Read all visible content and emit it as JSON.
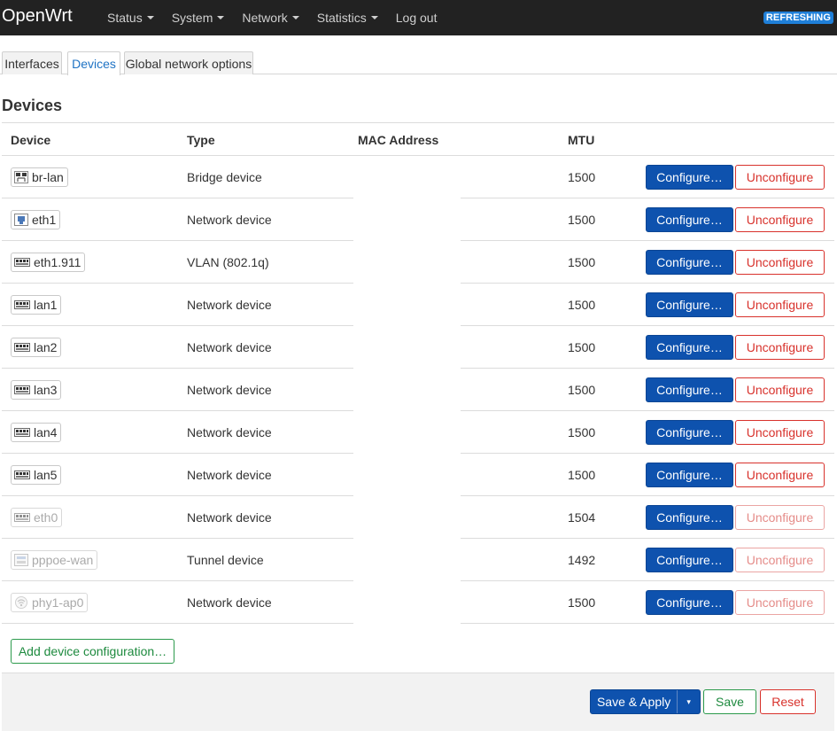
{
  "header": {
    "brand": "OpenWrt",
    "menu": [
      {
        "label": "Status",
        "dropdown": true
      },
      {
        "label": "System",
        "dropdown": true
      },
      {
        "label": "Network",
        "dropdown": true
      },
      {
        "label": "Statistics",
        "dropdown": true
      },
      {
        "label": "Log out",
        "dropdown": false
      }
    ],
    "badge": "REFRESHING"
  },
  "tabs": [
    {
      "label": "Interfaces",
      "active": false
    },
    {
      "label": "Devices",
      "active": true
    },
    {
      "label": "Global network options",
      "active": false
    }
  ],
  "section_title": "Devices",
  "table": {
    "columns": [
      "Device",
      "Type",
      "MAC Address",
      "MTU"
    ],
    "rows": [
      {
        "device": "br-lan",
        "icon": "bridge-icon",
        "type": "Bridge device",
        "mac": "",
        "mtu": "1500",
        "active": true
      },
      {
        "device": "eth1",
        "icon": "ethernet-icon",
        "type": "Network device",
        "mac": "",
        "mtu": "1500",
        "active": true
      },
      {
        "device": "eth1.911",
        "icon": "switch-port-icon",
        "type": "VLAN (802.1q)",
        "mac": "",
        "mtu": "1500",
        "active": true
      },
      {
        "device": "lan1",
        "icon": "switch-port-icon",
        "type": "Network device",
        "mac": "",
        "mtu": "1500",
        "active": true
      },
      {
        "device": "lan2",
        "icon": "switch-port-icon",
        "type": "Network device",
        "mac": "",
        "mtu": "1500",
        "active": true
      },
      {
        "device": "lan3",
        "icon": "switch-port-icon",
        "type": "Network device",
        "mac": "",
        "mtu": "1500",
        "active": true
      },
      {
        "device": "lan4",
        "icon": "switch-port-icon",
        "type": "Network device",
        "mac": "",
        "mtu": "1500",
        "active": true
      },
      {
        "device": "lan5",
        "icon": "switch-port-icon",
        "type": "Network device",
        "mac": "",
        "mtu": "1500",
        "active": true
      },
      {
        "device": "eth0",
        "icon": "switch-port-icon",
        "type": "Network device",
        "mac": "",
        "mtu": "1504",
        "active": false
      },
      {
        "device": "pppoe-wan",
        "icon": "tunnel-icon",
        "type": "Tunnel device",
        "mac": "",
        "mtu": "1492",
        "active": false
      },
      {
        "device": "phy1-ap0",
        "icon": "wifi-icon",
        "type": "Network device",
        "mac": "",
        "mtu": "1500",
        "active": false
      }
    ],
    "configure_label": "Configure…",
    "unconfigure_label": "Unconfigure"
  },
  "add_button": "Add device configuration…",
  "footer": {
    "save_apply": "Save & Apply",
    "dropdown_glyph": "▾",
    "save": "Save",
    "reset": "Reset"
  },
  "colors": {
    "header_bg": "#222222",
    "primary": "#0e52ae",
    "success": "#1d8a3e",
    "danger": "#d8322c",
    "badge": "#1f7fd8",
    "active_tab": "#1f73c4"
  }
}
